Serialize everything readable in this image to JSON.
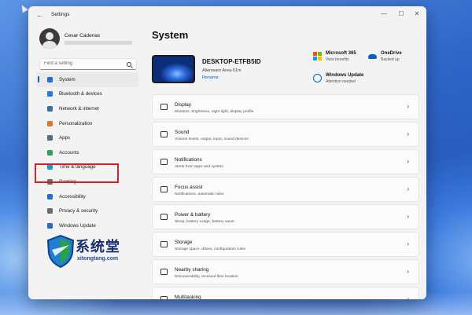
{
  "window": {
    "title": "Settings",
    "controls": {
      "minimize": "—",
      "maximize": "☐",
      "close": "✕"
    }
  },
  "user": {
    "name": "Cesar Cadenas"
  },
  "search": {
    "placeholder": "Find a setting"
  },
  "sidebar": {
    "items": [
      {
        "label": "System",
        "icon": "system-icon",
        "color": "#1f6fd1",
        "active": true
      },
      {
        "label": "Bluetooth & devices",
        "icon": "bluetooth-icon",
        "color": "#2a7bd6"
      },
      {
        "label": "Network & internet",
        "icon": "wifi-icon",
        "color": "#3a6ea8"
      },
      {
        "label": "Personalization",
        "icon": "brush-icon",
        "color": "#d97a2b"
      },
      {
        "label": "Apps",
        "icon": "apps-icon",
        "color": "#5a6b80"
      },
      {
        "label": "Accounts",
        "icon": "person-icon",
        "color": "#2ca25f"
      },
      {
        "label": "Time & language",
        "icon": "globe-clock-icon",
        "color": "#2196c9"
      },
      {
        "label": "Gaming",
        "icon": "gamepad-icon",
        "color": "#6b6b6b"
      },
      {
        "label": "Accessibility",
        "icon": "accessibility-icon",
        "color": "#1f6fd1"
      },
      {
        "label": "Privacy & security",
        "icon": "shield-icon",
        "color": "#6b6b6b"
      },
      {
        "label": "Windows Update",
        "icon": "update-icon",
        "color": "#1f6fd1"
      }
    ],
    "highlighted_item": "Time & language",
    "highlight_color": "#d2232a"
  },
  "main": {
    "title": "System",
    "device": {
      "name": "DESKTOP-ETFB5ID",
      "model": "Alienware Area-51m",
      "rename": "Rename"
    },
    "quick_links": [
      {
        "title": "Microsoft 365",
        "subtitle": "View benefits",
        "icon": "microsoft-icon"
      },
      {
        "title": "OneDrive",
        "subtitle": "Backed up",
        "icon": "cloud-icon"
      },
      {
        "title": "Windows Update",
        "subtitle": "Attention needed",
        "icon": "update-icon"
      }
    ],
    "settings": [
      {
        "title": "Display",
        "subtitle": "Monitors, brightness, night light, display profile",
        "icon": "monitor-icon"
      },
      {
        "title": "Sound",
        "subtitle": "Volume levels, output, input, sound devices",
        "icon": "speaker-icon"
      },
      {
        "title": "Notifications",
        "subtitle": "Alerts from apps and system",
        "icon": "bell-icon"
      },
      {
        "title": "Focus assist",
        "subtitle": "Notifications, automatic rules",
        "icon": "moon-icon"
      },
      {
        "title": "Power & battery",
        "subtitle": "Sleep, battery usage, battery saver",
        "icon": "power-icon"
      },
      {
        "title": "Storage",
        "subtitle": "Storage space, drives, configuration rules",
        "icon": "drive-icon"
      },
      {
        "title": "Nearby sharing",
        "subtitle": "Discoverability, received files location",
        "icon": "share-icon"
      },
      {
        "title": "Multitasking",
        "subtitle": "",
        "icon": "multitask-icon"
      }
    ]
  },
  "watermark": {
    "chinese": "系统堂",
    "url": "xitongtang.com"
  },
  "colors": {
    "accent": "#0067c0",
    "window_bg": "#f3f3f3",
    "card_bg": "#fbfbfb"
  }
}
